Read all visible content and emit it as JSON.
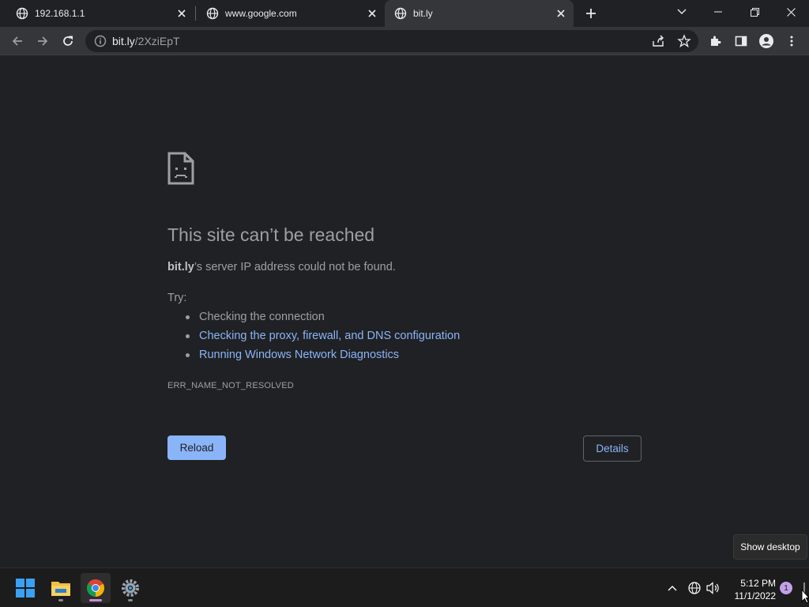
{
  "tabs": [
    {
      "title": "192.168.1.1",
      "active": false
    },
    {
      "title": "www.google.com",
      "active": false
    },
    {
      "title": "bit.ly",
      "active": true
    }
  ],
  "address_bar": {
    "host": "bit.ly",
    "path": "/2XziEpT"
  },
  "error_page": {
    "headline": "This site can’t be reached",
    "host_bold": "bit.ly",
    "message_rest": "’s server IP address could not be found.",
    "try_label": "Try:",
    "suggestions": [
      {
        "text": "Checking the connection",
        "is_link": false
      },
      {
        "text": "Checking the proxy, firewall, and DNS configuration",
        "is_link": true
      },
      {
        "text": "Running Windows Network Diagnostics",
        "is_link": true
      }
    ],
    "error_code": "ERR_NAME_NOT_RESOLVED",
    "reload_label": "Reload",
    "details_label": "Details"
  },
  "tooltip": "Show desktop",
  "taskbar": {
    "apps": [
      "start-icon",
      "file-explorer-icon",
      "chrome-icon",
      "settings-icon"
    ],
    "time": "5:12 PM",
    "date": "11/1/2022",
    "notification_count": "1"
  },
  "colors": {
    "page_bg": "#202124",
    "link": "#8ab4f8",
    "text": "#9aa0a6",
    "toolbar": "#35363a"
  }
}
